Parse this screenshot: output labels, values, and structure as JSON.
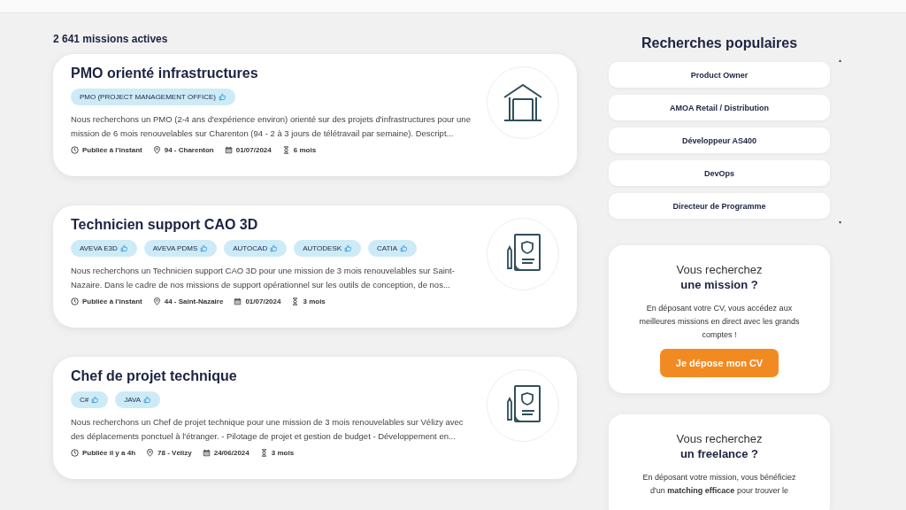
{
  "count": "2 641 missions actives",
  "missions": [
    {
      "title": "PMO orienté infrastructures",
      "kind": "building",
      "tags": [
        "PMO (PROJECT MANAGEMENT OFFICE)"
      ],
      "description": "Nous recherchons un PMO (2-4 ans d'expérience environ) orienté sur des projets d'infrastructures pour une mission de 6 mois renouvelables sur Charenton (94 - 2 à 3 jours de télétravail par semaine). Descript...",
      "published": "Publiée à l'instant",
      "location": "94 - Charenton",
      "date": "01/07/2024",
      "duration": "6 mois"
    },
    {
      "title": "Technicien support CAO 3D",
      "kind": "document",
      "tags": [
        "AVEVA E3D",
        "AVEVA PDMS",
        "AUTOCAD",
        "AUTODESK",
        "CATIA"
      ],
      "description": "Nous recherchons un Technicien support CAO 3D pour une mission de 3 mois renouvelables sur Saint-Nazaire. Dans le cadre de nos missions de support opérationnel sur les outils de conception, de nos...",
      "published": "Publiée à l'instant",
      "location": "44 - Saint-Nazaire",
      "date": "01/07/2024",
      "duration": "3 mois"
    },
    {
      "title": "Chef de projet technique",
      "kind": "document",
      "tags": [
        "C#",
        "JAVA"
      ],
      "description": "Nous recherchons un Chef de projet technique pour une mission de 3 mois renouvelables sur Vélizy avec des déplacements ponctuel à l'étranger.  - Pilotage de projet et gestion de budget  - Développement en...",
      "published": "Publiée il y a 4h",
      "location": "78 - Vélizy",
      "date": "24/06/2024",
      "duration": "3 mois"
    }
  ],
  "popular": {
    "title": "Recherches populaires",
    "items": [
      "Product Owner",
      "AMOA Retail / Distribution",
      "Développeur AS400",
      "DevOps",
      "Directeur de Programme"
    ]
  },
  "promos": [
    {
      "line1": "Vous recherchez",
      "line2": "une mission ?",
      "text": "En déposant votre CV, vous accédez aux meilleures missions en direct avec les grands comptes !",
      "button": "Je dépose mon CV"
    },
    {
      "line1": "Vous recherchez",
      "line2": "un freelance ?",
      "text": "En déposant votre mission, vous bénéficiez d'un **matching efficace** pour trouver le"
    }
  ]
}
